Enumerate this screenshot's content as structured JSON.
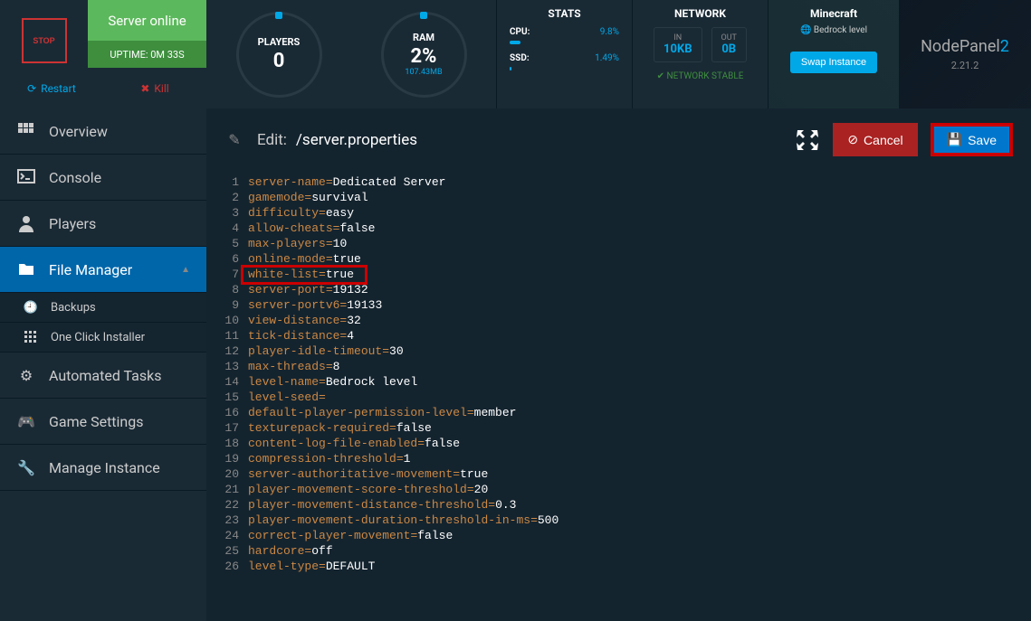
{
  "header": {
    "stop_label": "STOP",
    "status": "Server online",
    "uptime": "UPTIME: 0M 33S",
    "players": {
      "title": "PLAYERS",
      "value": "0"
    },
    "ram": {
      "title": "RAM",
      "value": "2%",
      "sub": "107.43MB"
    },
    "stats": {
      "title": "STATS",
      "cpu_label": "CPU:",
      "cpu_val": "9.8%",
      "ssd_label": "SSD:",
      "ssd_val": "1.49%"
    },
    "network": {
      "title": "NETWORK",
      "in_label": "IN",
      "in_val": "10KB",
      "out_label": "OUT",
      "out_val": "0B",
      "stable": "NETWORK STABLE"
    },
    "minecraft": {
      "title": "Minecraft",
      "level": "Bedrock level",
      "swap": "Swap Instance"
    },
    "nodepanel": {
      "name": "NodePanel",
      "suffix": "2",
      "version": "2.21.2"
    }
  },
  "actions": {
    "restart": "Restart",
    "kill": "Kill"
  },
  "nav": {
    "overview": "Overview",
    "console": "Console",
    "players": "Players",
    "file_manager": "File Manager",
    "backups": "Backups",
    "one_click": "One Click Installer",
    "automated": "Automated Tasks",
    "game_settings": "Game Settings",
    "manage": "Manage Instance"
  },
  "editor": {
    "edit_label": "Edit:",
    "path": "/server.properties",
    "cancel": "Cancel",
    "save": "Save",
    "lines": [
      {
        "n": "1",
        "k": "server-name",
        "v": "Dedicated Server"
      },
      {
        "n": "2",
        "k": "gamemode",
        "v": "survival"
      },
      {
        "n": "3",
        "k": "difficulty",
        "v": "easy"
      },
      {
        "n": "4",
        "k": "allow-cheats",
        "v": "false"
      },
      {
        "n": "5",
        "k": "max-players",
        "v": "10"
      },
      {
        "n": "6",
        "k": "online-mode",
        "v": "true"
      },
      {
        "n": "7",
        "k": "white-list",
        "v": "true"
      },
      {
        "n": "8",
        "k": "server-port",
        "v": "19132"
      },
      {
        "n": "9",
        "k": "server-portv6",
        "v": "19133"
      },
      {
        "n": "10",
        "k": "view-distance",
        "v": "32"
      },
      {
        "n": "11",
        "k": "tick-distance",
        "v": "4"
      },
      {
        "n": "12",
        "k": "player-idle-timeout",
        "v": "30"
      },
      {
        "n": "13",
        "k": "max-threads",
        "v": "8"
      },
      {
        "n": "14",
        "k": "level-name",
        "v": "Bedrock level"
      },
      {
        "n": "15",
        "k": "level-seed",
        "v": ""
      },
      {
        "n": "16",
        "k": "default-player-permission-level",
        "v": "member"
      },
      {
        "n": "17",
        "k": "texturepack-required",
        "v": "false"
      },
      {
        "n": "18",
        "k": "content-log-file-enabled",
        "v": "false"
      },
      {
        "n": "19",
        "k": "compression-threshold",
        "v": "1"
      },
      {
        "n": "20",
        "k": "server-authoritative-movement",
        "v": "true"
      },
      {
        "n": "21",
        "k": "player-movement-score-threshold",
        "v": "20"
      },
      {
        "n": "22",
        "k": "player-movement-distance-threshold",
        "v": "0.3"
      },
      {
        "n": "23",
        "k": "player-movement-duration-threshold-in-ms",
        "v": "500"
      },
      {
        "n": "24",
        "k": "correct-player-movement",
        "v": "false"
      },
      {
        "n": "25",
        "k": "hardcore",
        "v": "off"
      },
      {
        "n": "26",
        "k": "level-type",
        "v": "DEFAULT"
      }
    ]
  }
}
